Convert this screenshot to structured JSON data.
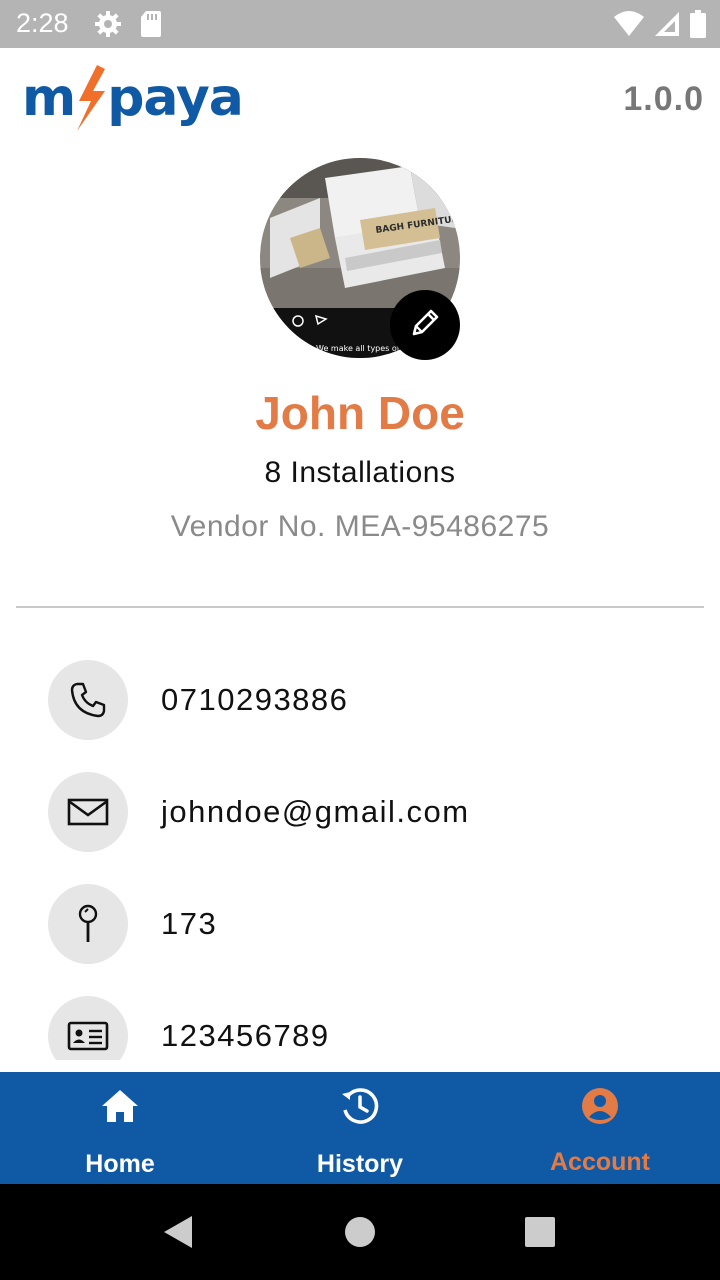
{
  "status_bar": {
    "time": "2:28",
    "icons": [
      "settings-icon",
      "sd-card-icon",
      "wifi-icon",
      "signal-icon",
      "battery-icon"
    ]
  },
  "header": {
    "logo_left": "m",
    "logo_right": "paya",
    "version": "1.0.0"
  },
  "profile": {
    "name": "John Doe",
    "installations": "8 Installations",
    "vendor_no": "Vendor No. MEA-95486275",
    "photo_caption": "BAGH FURNITURE",
    "photo_overlay_text": "We make all types of ku"
  },
  "contacts": [
    {
      "icon": "phone-icon",
      "value": "0710293886"
    },
    {
      "icon": "email-icon",
      "value": "johndoe@gmail.com"
    },
    {
      "icon": "location-pin-icon",
      "value": "173"
    },
    {
      "icon": "id-card-icon",
      "value": "123456789"
    }
  ],
  "bottom_nav": {
    "items": [
      {
        "label": "Home",
        "icon": "home-icon",
        "active": false
      },
      {
        "label": "History",
        "icon": "history-icon",
        "active": false
      },
      {
        "label": "Account",
        "icon": "account-icon",
        "active": true
      }
    ]
  },
  "colors": {
    "brand_blue": "#1059a5",
    "accent_orange": "#e27b45",
    "status_bar": "#b4b4b4",
    "icon_circle": "#e6e6e6"
  }
}
